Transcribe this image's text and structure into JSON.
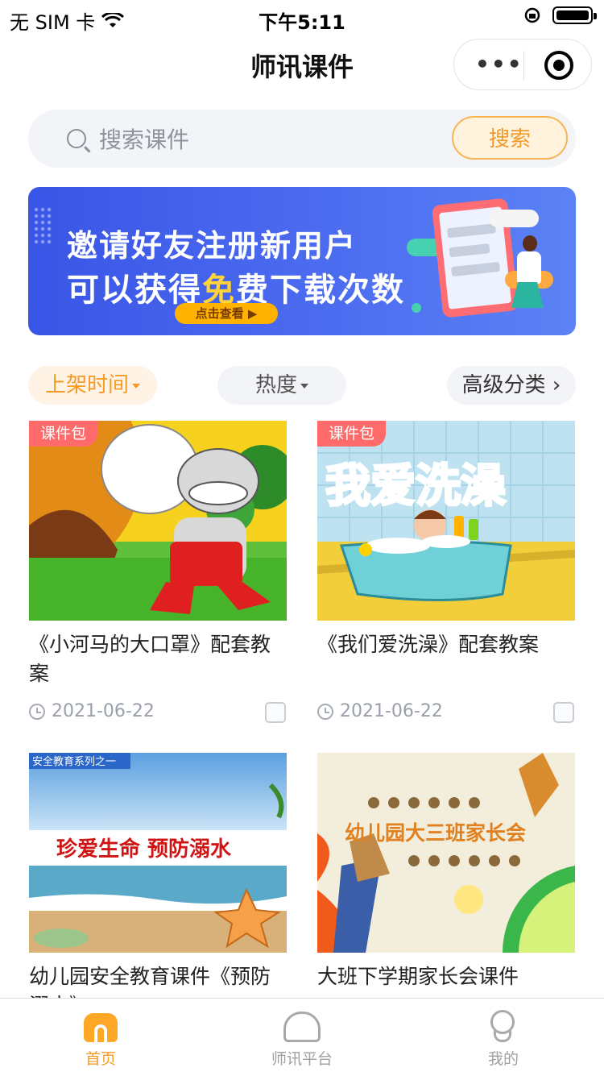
{
  "status_bar": {
    "carrier": "无 SIM 卡",
    "time": "下午5:11"
  },
  "nav": {
    "title": "师讯课件",
    "more_icon": "more-dots-icon",
    "close_icon": "target-circle-icon"
  },
  "search": {
    "placeholder": "搜索课件",
    "button_label": "搜索"
  },
  "banner": {
    "line1": "邀请好友注册新用户",
    "line2_a": "可以获得",
    "line2_highlight": "免",
    "line2_b": "费下载次数",
    "cta": "点击查看 ▶"
  },
  "filters": [
    {
      "label": "上架时间",
      "active": true
    },
    {
      "label": "热度",
      "active": false
    },
    {
      "label": "高级分类 ›",
      "active": false
    }
  ],
  "cards": [
    {
      "tag": "课件包",
      "title": "《小河马的大口罩》配套教案",
      "date": "2021-06-22",
      "image": "cartoon-hippo-wearing-mask"
    },
    {
      "tag": "课件包",
      "title": "《我们爱洗澡》配套教案",
      "date": "2021-06-22",
      "image": "cartoon-boy-bathtub"
    },
    {
      "tag": "",
      "title": "幼儿园安全教育课件《预防溺水》",
      "date": "",
      "image": "beach-starfish-safety",
      "image_text_top": "安全教育系列之一",
      "image_text_main": "珍爱生命 预防溺水"
    },
    {
      "tag": "",
      "title": "大班下学期家长会课件",
      "date": "",
      "image": "kindergarten-parent-meeting",
      "image_text_main": "幼儿园大三班家长会"
    }
  ],
  "card_images": {
    "bath_title": "我爱洗澡"
  },
  "tabbar": [
    {
      "label": "首页",
      "icon": "home-icon",
      "active": true
    },
    {
      "label": "师讯平台",
      "icon": "elephant-icon",
      "active": false
    },
    {
      "label": "我的",
      "icon": "user-icon",
      "active": false
    }
  ],
  "colors": {
    "accent": "#f59a23",
    "tag": "#ff6b6b",
    "banner": "#4c6cf0"
  }
}
